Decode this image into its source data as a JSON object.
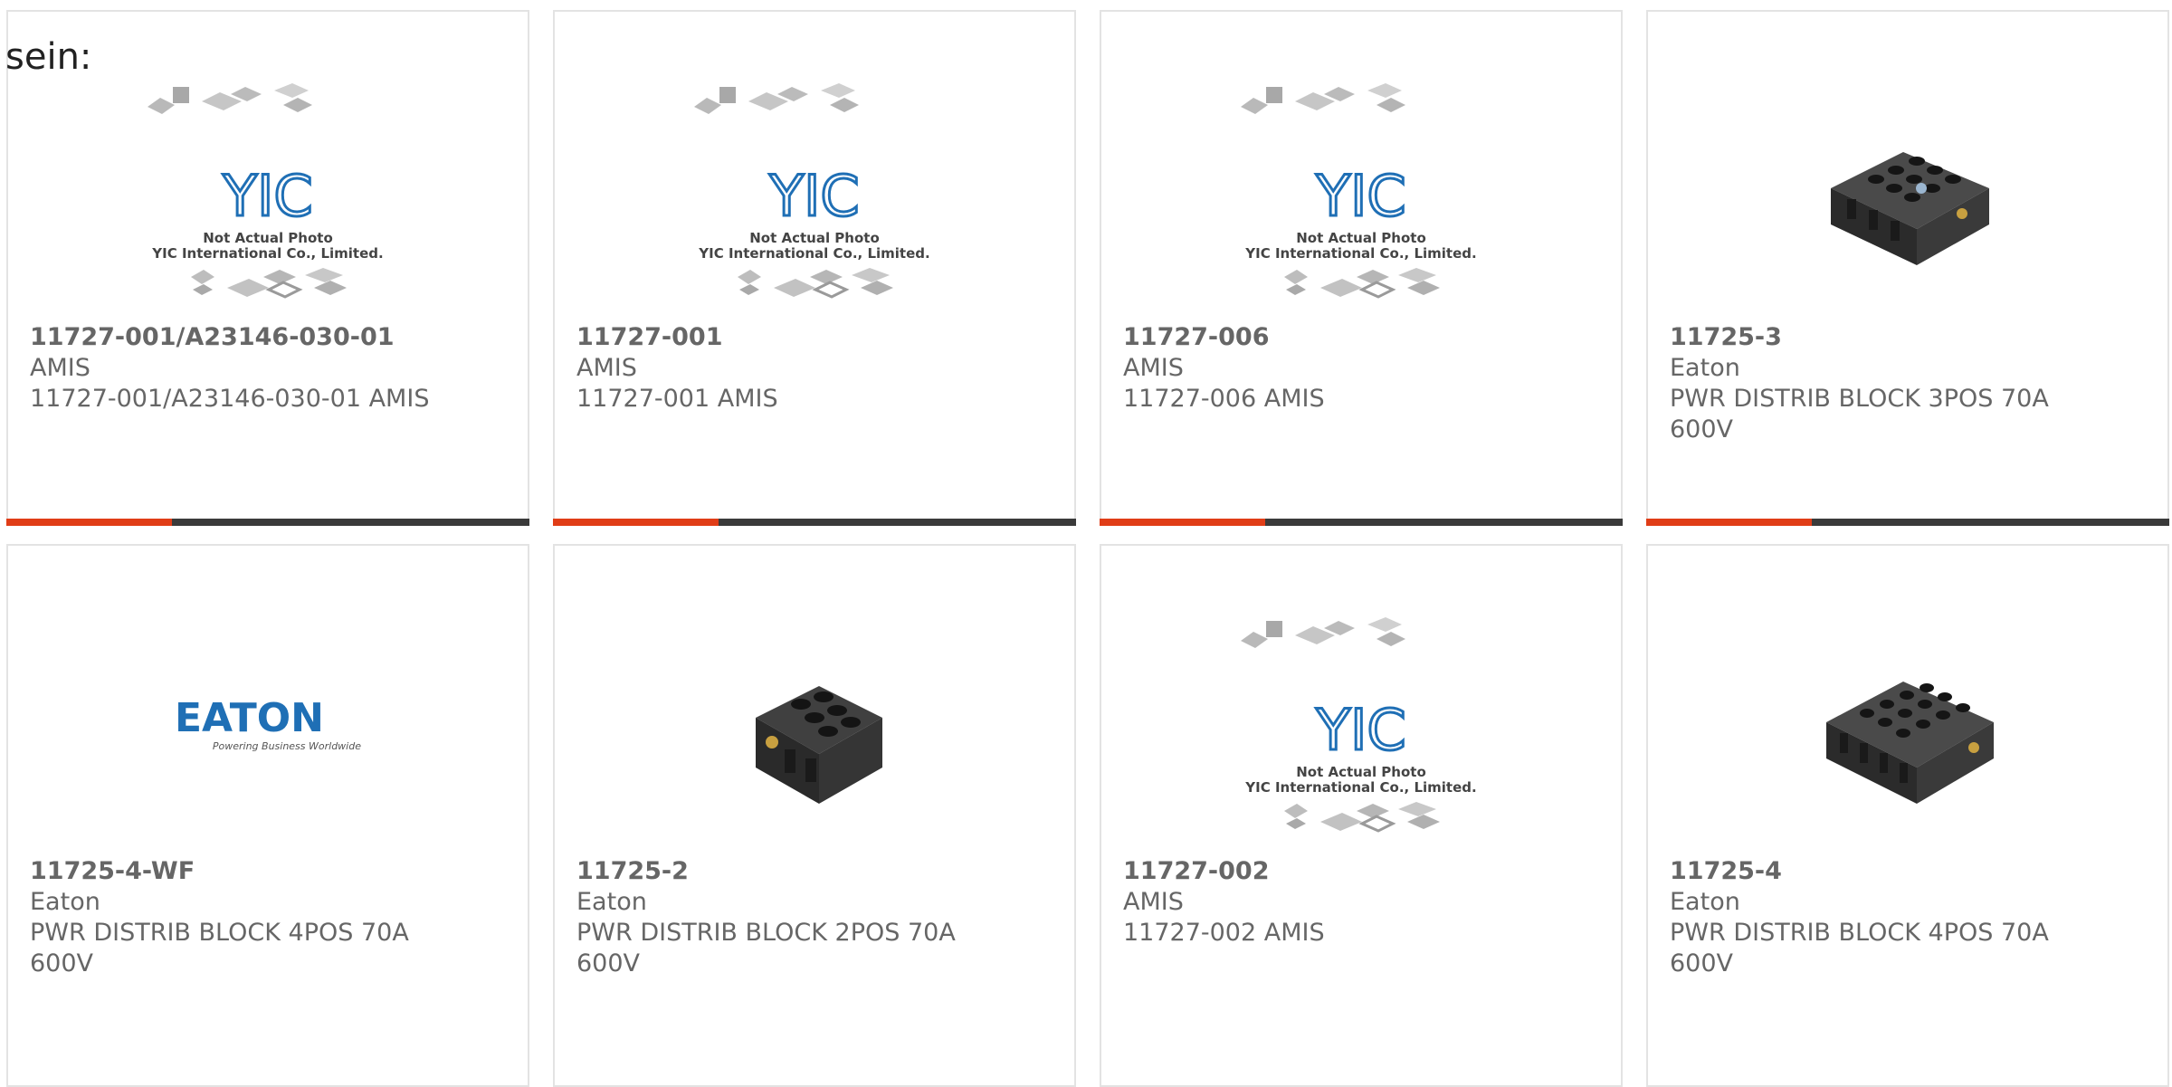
{
  "page": {
    "top_text": "sein:"
  },
  "placeholder_image": {
    "brand": "YIC",
    "line1": "Not Actual Photo",
    "line2": "YIC International Co., Limited."
  },
  "eaton_logo": {
    "brand": "EATON",
    "tagline": "Powering Business Worldwide"
  },
  "products": [
    {
      "part_number": "11727-001/A23146-030-01",
      "manufacturer": "AMIS",
      "description": "11727-001/A23146-030-01 AMIS",
      "image": "placeholder"
    },
    {
      "part_number": "11727-001",
      "manufacturer": "AMIS",
      "description": "11727-001 AMIS",
      "image": "placeholder"
    },
    {
      "part_number": "11727-006",
      "manufacturer": "AMIS",
      "description": "11727-006 AMIS",
      "image": "placeholder"
    },
    {
      "part_number": "11725-3",
      "manufacturer": "Eaton",
      "description_line1": "PWR DISTRIB BLOCK 3POS 70A",
      "description_line2": "600V",
      "image": "block-3pos"
    },
    {
      "part_number": "11725-4-WF",
      "manufacturer": "Eaton",
      "description_line1": "PWR DISTRIB BLOCK 4POS 70A",
      "description_line2": "600V",
      "image": "eaton-logo"
    },
    {
      "part_number": "11725-2",
      "manufacturer": "Eaton",
      "description_line1": "PWR DISTRIB BLOCK 2POS 70A",
      "description_line2": "600V",
      "image": "block-2pos"
    },
    {
      "part_number": "11727-002",
      "manufacturer": "AMIS",
      "description": "11727-002 AMIS",
      "image": "placeholder"
    },
    {
      "part_number": "11725-4",
      "manufacturer": "Eaton",
      "description_line1": "PWR DISTRIB BLOCK 4POS 70A",
      "description_line2": "600V",
      "image": "block-4pos"
    }
  ],
  "colors": {
    "accent": "#e03d17",
    "bar": "#3a3a3a",
    "text": "#666666",
    "logo_blue": "#1f6fb5"
  }
}
